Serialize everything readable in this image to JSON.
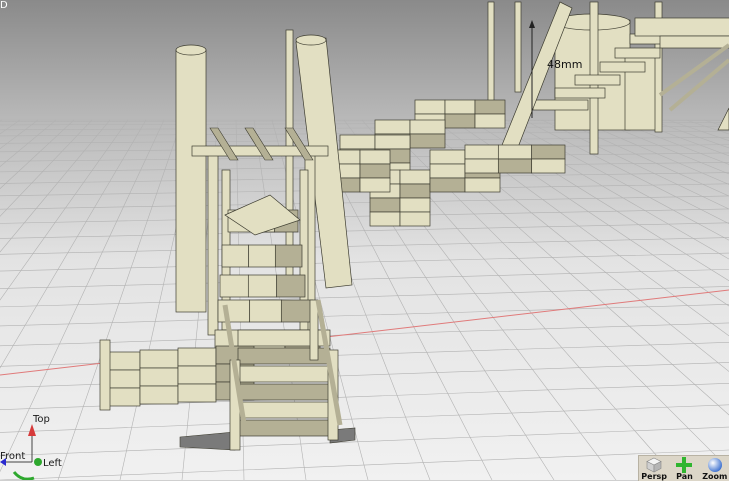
{
  "viewport": {
    "corner_label": "D",
    "dimension_label": "48mm",
    "colors": {
      "component": "#e2dfc2",
      "component_shadow": "#b4b095",
      "outline": "#3e3d31",
      "grid_line": "#b2b2b2",
      "x_axis": "#e07a7a",
      "floor_plate": "#6f6f6f"
    }
  },
  "orientation_triad": {
    "top_label": "Top",
    "front_label": "Front",
    "left_label": "Left",
    "colors": {
      "top": "#d63a3a",
      "front": "#2b2bd0",
      "left": "#2ea82e"
    }
  },
  "toolbar": {
    "buttons": [
      {
        "label": "Persp",
        "icon": "cube-icon"
      },
      {
        "label": "Pan",
        "icon": "pan-cross-icon"
      },
      {
        "label": "Zoom",
        "icon": "zoom-sphere-icon"
      }
    ]
  }
}
